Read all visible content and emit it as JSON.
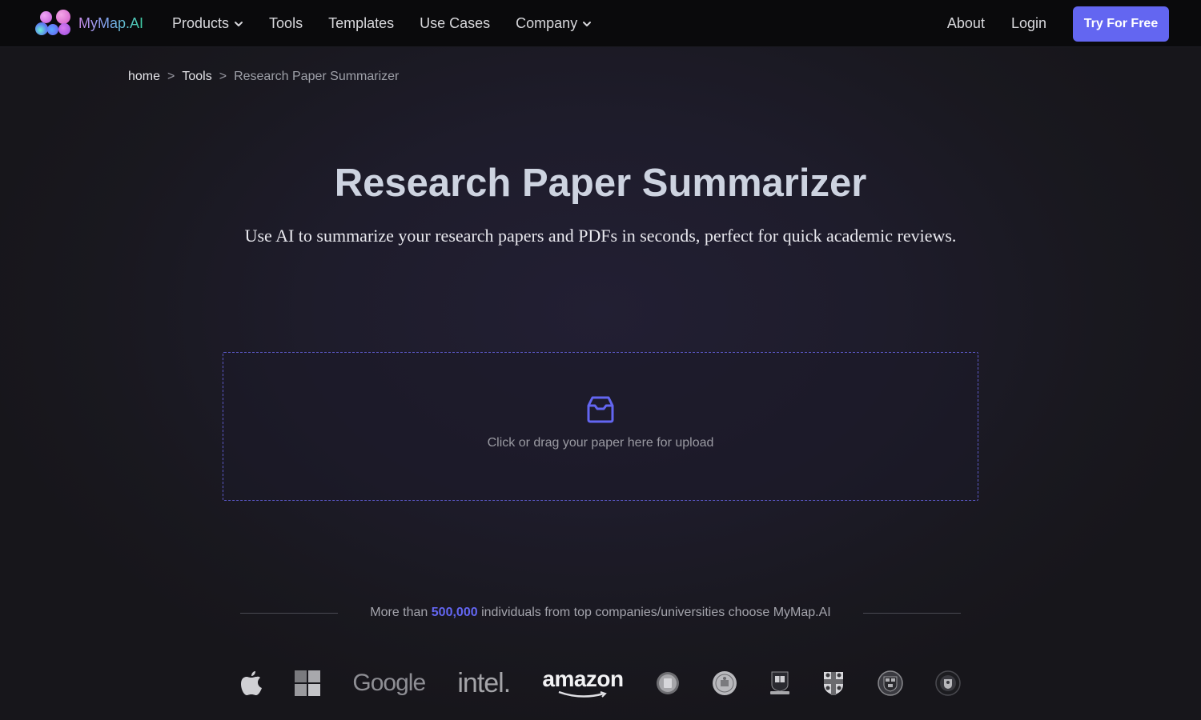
{
  "nav": {
    "brand": "MyMap.AI",
    "links": [
      {
        "label": "Products",
        "dropdown": true
      },
      {
        "label": "Tools",
        "dropdown": false
      },
      {
        "label": "Templates",
        "dropdown": false
      },
      {
        "label": "Use Cases",
        "dropdown": false
      },
      {
        "label": "Company",
        "dropdown": true
      }
    ],
    "about": "About",
    "login": "Login",
    "cta": "Try For Free"
  },
  "breadcrumb": {
    "home": "home",
    "separator": ">",
    "tools": "Tools",
    "current": "Research Paper Summarizer"
  },
  "hero": {
    "title": "Research Paper Summarizer",
    "subtitle": "Use AI to summarize your research papers and PDFs in seconds, perfect for quick academic reviews."
  },
  "upload": {
    "icon": "inbox-icon",
    "text": "Click or drag your paper here for upload"
  },
  "trust": {
    "prefix": "More than",
    "count": "500,000",
    "suffix": "individuals from top companies/universities choose MyMap.AI"
  },
  "logos": [
    {
      "name": "apple",
      "label": ""
    },
    {
      "name": "microsoft",
      "label": ""
    },
    {
      "name": "google",
      "label": "Google"
    },
    {
      "name": "intel",
      "label": "intel."
    },
    {
      "name": "amazon",
      "label": "amazon"
    },
    {
      "name": "university-seal-1",
      "label": ""
    },
    {
      "name": "university-seal-2",
      "label": ""
    },
    {
      "name": "yale",
      "label": ""
    },
    {
      "name": "cambridge",
      "label": ""
    },
    {
      "name": "harvard",
      "label": ""
    },
    {
      "name": "university-seal-3",
      "label": ""
    }
  ],
  "colors": {
    "accent": "#6366f1",
    "background": "#18171d",
    "nav_background": "#0a0a0c"
  }
}
